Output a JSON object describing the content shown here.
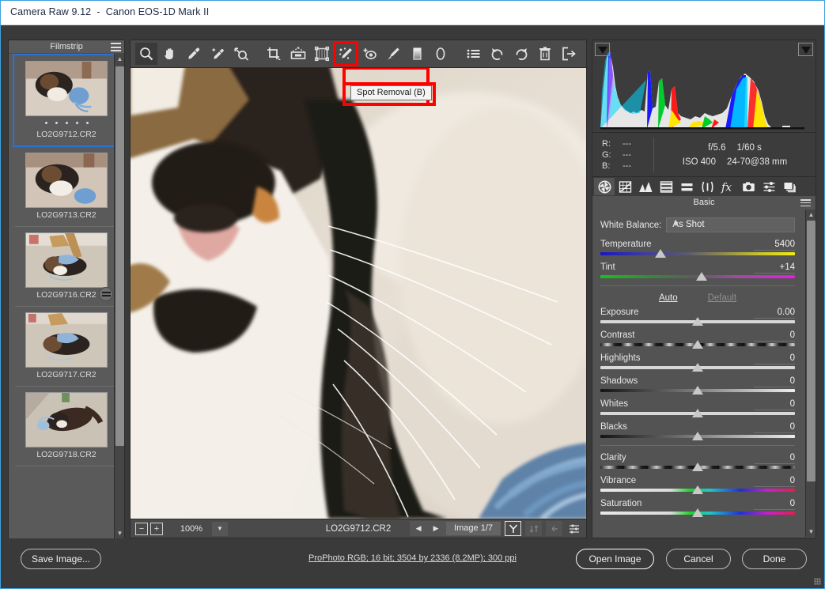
{
  "window": {
    "title": "Camera Raw 9.12  -  Canon EOS-1D Mark II"
  },
  "filmstrip": {
    "title": "Filmstrip",
    "menu_icon": "hamburger-icon",
    "items": [
      {
        "label": "LO2G9712.CR2",
        "selected": true,
        "rating_dots": 5,
        "badge": false
      },
      {
        "label": "LO2G9713.CR2",
        "selected": false,
        "rating_dots": 0,
        "badge": false
      },
      {
        "label": "LO2G9716.CR2",
        "selected": false,
        "rating_dots": 0,
        "badge": true
      },
      {
        "label": "LO2G9717.CR2",
        "selected": false,
        "rating_dots": 0,
        "badge": false
      },
      {
        "label": "LO2G9718.CR2",
        "selected": false,
        "rating_dots": 0,
        "badge": false
      }
    ]
  },
  "toolbar": {
    "tools": [
      {
        "name": "zoom-tool",
        "icon": "magnifier-icon",
        "active": true
      },
      {
        "name": "hand-tool",
        "icon": "hand-icon",
        "active": false
      },
      {
        "name": "white-balance-tool",
        "icon": "eyedropper-icon",
        "active": false
      },
      {
        "name": "color-sampler-tool",
        "icon": "color-sampler-icon",
        "active": false
      },
      {
        "name": "targeted-adjustment-tool",
        "icon": "targeted-adjustment-icon",
        "active": false
      },
      {
        "name": "crop-tool",
        "icon": "crop-icon",
        "active": false
      },
      {
        "name": "straighten-tool",
        "icon": "straighten-icon",
        "active": false
      },
      {
        "name": "transform-tool",
        "icon": "transform-icon",
        "active": false
      },
      {
        "name": "spot-removal-tool",
        "icon": "spot-removal-icon",
        "active": false,
        "highlighted": true
      },
      {
        "name": "red-eye-removal-tool",
        "icon": "red-eye-icon",
        "active": false
      },
      {
        "name": "adjustment-brush-tool",
        "icon": "brush-icon",
        "active": false
      },
      {
        "name": "graduated-filter-tool",
        "icon": "graduated-filter-icon",
        "active": false
      },
      {
        "name": "radial-filter-tool",
        "icon": "radial-filter-icon",
        "active": false
      },
      {
        "name": "presets-menu-tool",
        "icon": "list-icon",
        "active": false
      },
      {
        "name": "rotate-counterclockwise-tool",
        "icon": "rotate-ccw-icon",
        "active": false
      },
      {
        "name": "rotate-clockwise-tool",
        "icon": "rotate-cw-icon",
        "active": false
      },
      {
        "name": "delete-image-tool",
        "icon": "trash-icon",
        "active": false
      },
      {
        "name": "open-preferences-tool",
        "icon": "export-icon",
        "active": false
      }
    ],
    "tooltip": "Spot Removal (B)"
  },
  "preview": {
    "zoom_out_label": "−",
    "zoom_in_label": "+",
    "zoom_level": "100%",
    "zoom_dropdown_icon": "chevron-down-icon",
    "filename": "LO2G9712.CR2",
    "prev_icon": "triangle-left-icon",
    "next_icon": "triangle-right-icon",
    "image_counter": "Image 1/7",
    "toggle_before_after": "Y",
    "swap_icon": "swap-icon",
    "copy_icon": "copy-settings-icon",
    "preferences_icon": "sliders-icon"
  },
  "histogram": {
    "shadow_clipping_icon": "shadow-clipping-triangle-icon",
    "highlight_clipping_icon": "highlight-clipping-triangle-icon"
  },
  "exif": {
    "r_label": "R:",
    "g_label": "G:",
    "b_label": "B:",
    "r_value": "---",
    "g_value": "---",
    "b_value": "---",
    "aperture": "f/5.6",
    "shutter": "1/60 s",
    "iso": "ISO 400",
    "lens": "24-70@38 mm"
  },
  "panel_tabs": [
    {
      "name": "tab-basic",
      "icon": "aperture-icon",
      "active": true
    },
    {
      "name": "tab-tone-curve",
      "icon": "tone-curve-icon",
      "active": false
    },
    {
      "name": "tab-detail",
      "icon": "detail-triangles-icon",
      "active": false
    },
    {
      "name": "tab-hsl-grayscale",
      "icon": "hsl-icon",
      "active": false
    },
    {
      "name": "tab-split-toning",
      "icon": "split-toning-icon",
      "active": false
    },
    {
      "name": "tab-lens-corrections",
      "icon": "lens-corrections-icon",
      "active": false
    },
    {
      "name": "tab-effects",
      "icon": "fx-icon",
      "active": false
    },
    {
      "name": "tab-camera-calibration",
      "icon": "camera-icon",
      "active": false
    },
    {
      "name": "tab-presets",
      "icon": "presets-sliders-icon",
      "active": false
    },
    {
      "name": "tab-snapshots",
      "icon": "snapshots-layers-icon",
      "active": false
    }
  ],
  "basic_panel": {
    "title": "Basic",
    "menu_icon": "hamburger-icon",
    "white_balance_label": "White Balance:",
    "white_balance_value": "As Shot",
    "white_balance_chevron": "chevron-down-icon",
    "auto_label": "Auto",
    "default_label": "Default",
    "sliders": [
      {
        "label": "Temperature",
        "value": "5400",
        "knob_pct": 31,
        "track": "grad-temp"
      },
      {
        "label": "Tint",
        "value": "+14",
        "knob_pct": 52,
        "track": "grad-tint"
      },
      {
        "label": "Exposure",
        "value": "0.00",
        "knob_pct": 50,
        "track": "grad-flat"
      },
      {
        "label": "Contrast",
        "value": "0",
        "knob_pct": 50,
        "track": "grad-contrast"
      },
      {
        "label": "Highlights",
        "value": "0",
        "knob_pct": 50,
        "track": "grad-flat"
      },
      {
        "label": "Shadows",
        "value": "0",
        "knob_pct": 50,
        "track": "grad-dark2light"
      },
      {
        "label": "Whites",
        "value": "0",
        "knob_pct": 50,
        "track": "grad-flat"
      },
      {
        "label": "Blacks",
        "value": "0",
        "knob_pct": 50,
        "track": "grad-dark2light"
      },
      {
        "label": "Clarity",
        "value": "0",
        "knob_pct": 50,
        "track": "grad-clarity"
      },
      {
        "label": "Vibrance",
        "value": "0",
        "knob_pct": 50,
        "track": "grad-vibrance"
      },
      {
        "label": "Saturation",
        "value": "0",
        "knob_pct": 50,
        "track": "grad-vibrance"
      }
    ]
  },
  "bottom": {
    "save_label": "Save Image...",
    "workflow_options": "ProPhoto RGB; 16 bit; 3504 by 2336 (8.2MP); 300 ppi",
    "open_label": "Open Image",
    "cancel_label": "Cancel",
    "done_label": "Done"
  },
  "colors": {
    "accent_blue": "#2a72d4",
    "annotation_red": "#ff0000",
    "panel_bg": "#535353",
    "app_bg": "#3a3a3a"
  }
}
